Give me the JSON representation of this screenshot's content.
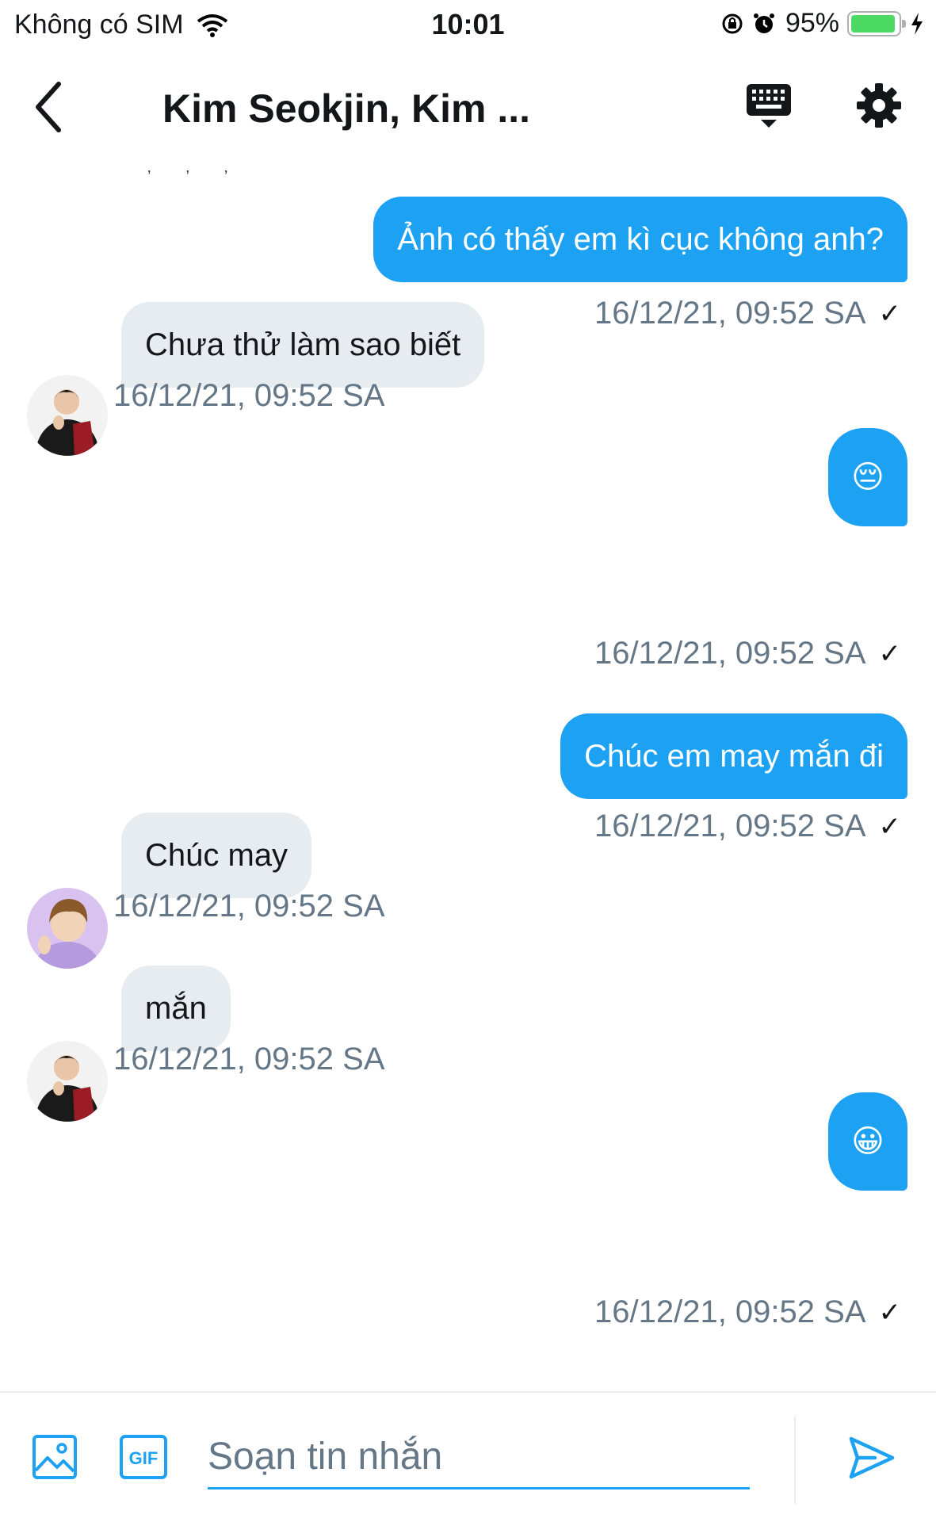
{
  "status_bar": {
    "carrier": "Không có SIM",
    "time": "10:01",
    "battery_percent": "95%",
    "battery_level": 0.95,
    "battery_color": "#4cd964"
  },
  "header": {
    "title": "Kim Seokjin, Kim ...",
    "back_icon": "chevron-left-icon",
    "keyboard_icon": "keyboard-icon",
    "settings_icon": "gear-icon"
  },
  "colors": {
    "accent": "#1da1f2",
    "incoming_bubble": "#e6ecf0",
    "timestamp": "#657786"
  },
  "messages": [
    {
      "direction": "out",
      "text": "Ảnh có thấy em kì cục không anh?",
      "time": "16/12/21, 09:52 SA",
      "status": "✓"
    },
    {
      "direction": "in",
      "sender_avatar": "avatar-1",
      "text": "Chưa thử làm sao biết",
      "time": "16/12/21, 09:52 SA"
    },
    {
      "direction": "out",
      "text": "😔",
      "time": "16/12/21, 09:52 SA",
      "status": "✓"
    },
    {
      "direction": "out",
      "text": "Chúc em may mắn đi",
      "time": "16/12/21, 09:52 SA",
      "status": "✓"
    },
    {
      "direction": "in",
      "sender_avatar": "avatar-2",
      "text": "Chúc may",
      "time": "16/12/21, 09:52 SA"
    },
    {
      "direction": "in",
      "sender_avatar": "avatar-1",
      "text": "mắn",
      "time": "16/12/21, 09:52 SA"
    },
    {
      "direction": "out",
      "text": "😀",
      "time": "16/12/21, 09:52 SA",
      "status": "✓"
    }
  ],
  "composer": {
    "placeholder": "Soạn tin nhắn",
    "value": "",
    "image_icon": "image-icon",
    "gif_label": "GIF",
    "send_icon": "send-icon"
  }
}
